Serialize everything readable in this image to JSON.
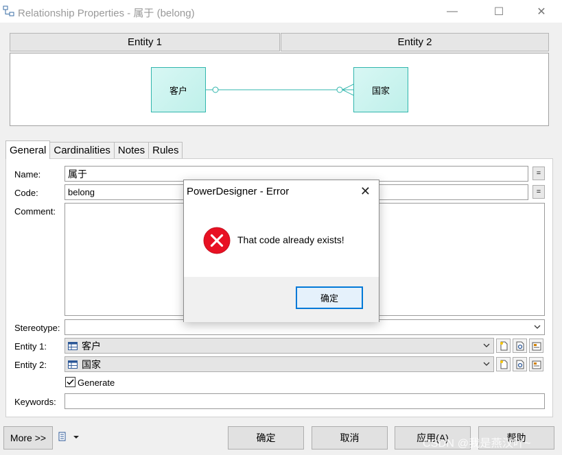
{
  "window": {
    "title": "Relationship Properties - 属于 (belong)",
    "minimize_glyph": "—",
    "maximize_glyph": "☐",
    "close_glyph": "✕"
  },
  "diagram": {
    "entity1_header": "Entity 1",
    "entity2_header": "Entity 2",
    "entity1_name": "客户",
    "entity2_name": "国家",
    "line_color": "#2fb5ac"
  },
  "tabs": [
    {
      "label": "General",
      "active": true
    },
    {
      "label": "Cardinalities",
      "active": false
    },
    {
      "label": "Notes",
      "active": false
    },
    {
      "label": "Rules",
      "active": false
    }
  ],
  "form": {
    "name_label": "Name:",
    "name_value": "属于",
    "code_label": "Code:",
    "code_value": "belong",
    "eq_glyph": "=",
    "comment_label": "Comment:",
    "comment_value": "",
    "stereotype_label": "Stereotype:",
    "stereotype_value": "",
    "entity1_label": "Entity 1:",
    "entity1_value": "客户",
    "entity2_label": "Entity 2:",
    "entity2_value": "国家",
    "generate_label": "Generate",
    "generate_checked": true,
    "keywords_label": "Keywords:",
    "keywords_value": ""
  },
  "footer": {
    "more_label": "More >>",
    "ok_label": "确定",
    "cancel_label": "取消",
    "apply_label": "应用(A)",
    "help_label": "帮助"
  },
  "watermark": "CSDN @我是燕汉吖~",
  "error_dialog": {
    "title": "PowerDesigner - Error",
    "close_glyph": "✕",
    "message": "That code already exists!",
    "ok_label": "确定",
    "accent": "#0078d7",
    "icon_color": "#e81123"
  }
}
